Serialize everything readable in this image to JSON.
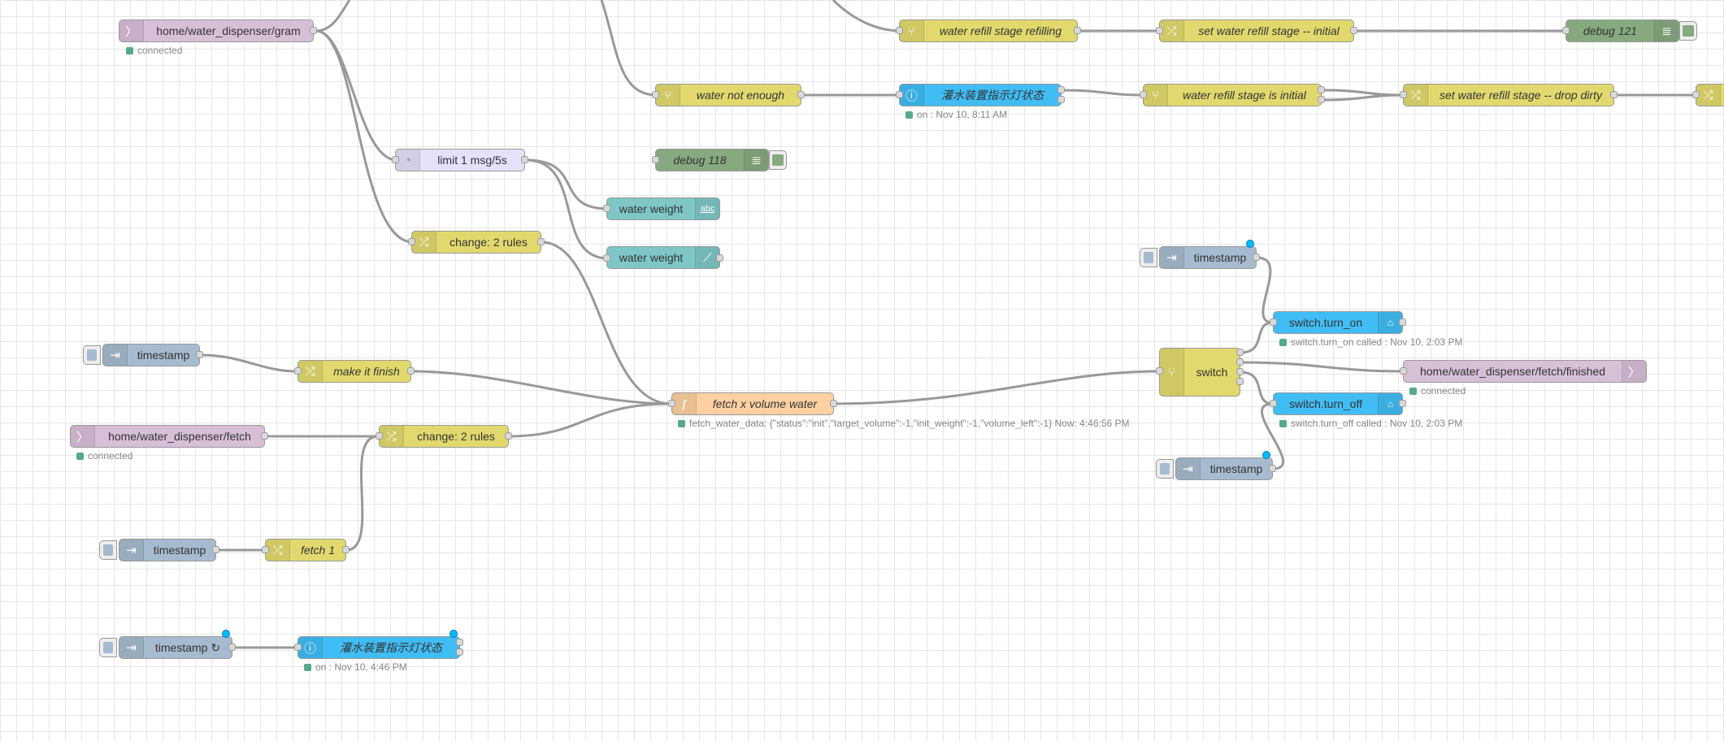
{
  "nodes": {
    "mqtt_in_gram": {
      "label": "home/water_dispenser/gram",
      "status": "connected"
    },
    "limit": {
      "label": "limit 1 msg/5s"
    },
    "change_rules_1": {
      "label": "change: 2 rules"
    },
    "water_not_enough": {
      "label": "water not enough"
    },
    "debug_118": {
      "label": "debug 118"
    },
    "water_weight_text": {
      "label": "water weight"
    },
    "water_weight_chart": {
      "label": "water weight"
    },
    "refill_refilling": {
      "label": "water refill stage refilling"
    },
    "set_stage_initial": {
      "label": "set water refill stage -- initial"
    },
    "debug_121": {
      "label": "debug 121"
    },
    "indicator_top": {
      "label": "灌水装置指示灯状态",
      "status": "on : Nov 10, 8:11 AM"
    },
    "refill_initial": {
      "label": "water refill stage is initial"
    },
    "set_drop_dirty": {
      "label": "set water refill stage -- drop dirty"
    },
    "timestamp_make": {
      "label": "timestamp"
    },
    "make_finish": {
      "label": "make it finish"
    },
    "mqtt_in_fetch": {
      "label": "home/water_dispenser/fetch",
      "status": "connected"
    },
    "change_rules_2": {
      "label": "change: 2 rules"
    },
    "fetch_volume": {
      "label": "fetch x volume water",
      "status": "fetch_water_data: {\"status\":\"init\",\"target_volume\":-1,\"init_weight\":-1,\"volume_left\":-1} Now: 4:46:56 PM"
    },
    "timestamp_fetch": {
      "label": "timestamp"
    },
    "fetch_1": {
      "label": "fetch 1"
    },
    "timestamp_repeat": {
      "label": "timestamp ↻"
    },
    "indicator_bottom": {
      "label": "灌水装置指示灯状态",
      "status": "on : Nov 10, 4:46 PM"
    },
    "timestamp_on": {
      "label": "timestamp"
    },
    "switch": {
      "label": "switch"
    },
    "turn_on": {
      "label": "switch.turn_on",
      "status": "switch.turn_on called : Nov 10, 2:03 PM"
    },
    "mqtt_out_finished": {
      "label": "home/water_dispenser/fetch/finished",
      "status": "connected"
    },
    "turn_off": {
      "label": "switch.turn_off",
      "status": "switch.turn_off called : Nov 10, 2:03 PM"
    },
    "timestamp_off": {
      "label": "timestamp"
    }
  },
  "colors": {
    "mqtt": "#d8bfd8",
    "inject": "#a6bbcf",
    "change": "#e2d96e",
    "switch": "#e2d96e",
    "delay": "#e6e0f8",
    "debug": "#87a980",
    "dashboard": "#7fc7c7",
    "homeassistant": "#41bdf5",
    "function": "#fdd0a2",
    "wire": "#999999",
    "grid": "#e6e6e6"
  },
  "icons": [
    "mqtt-icon",
    "inject-arrow-icon",
    "change-shuffle-icon",
    "switch-icon",
    "delay-icon",
    "debug-list-icon",
    "text-abc-icon",
    "chart-icon",
    "function-icon",
    "info-icon",
    "router-icon"
  ]
}
